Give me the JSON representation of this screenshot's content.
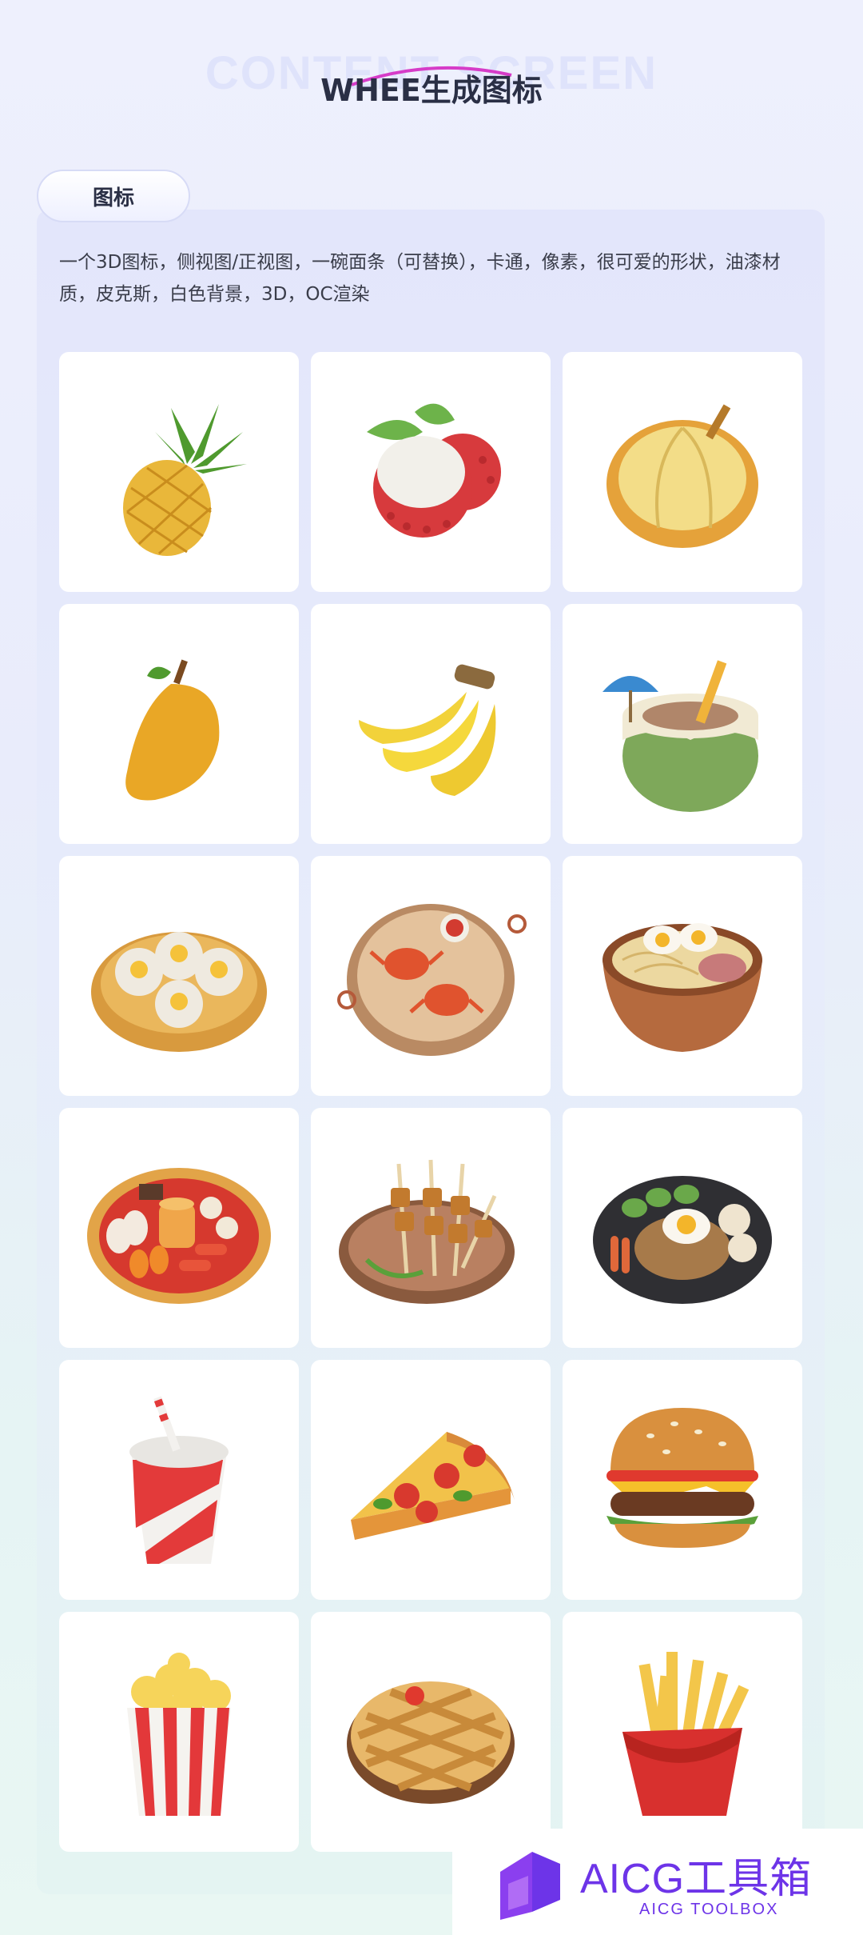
{
  "header": {
    "background_text": "CONTENT SCREEN",
    "title": "WHEE生成图标"
  },
  "section": {
    "tab_label": "图标",
    "description": "一个3D图标，侧视图/正视图，一碗面条（可替换），卡通，像素，很可爱的形状，油漆材质，皮克斯，白色背景，3D，OC渲染"
  },
  "grid": {
    "icons": [
      {
        "name": "pineapple-icon"
      },
      {
        "name": "lychee-icon"
      },
      {
        "name": "durian-icon"
      },
      {
        "name": "mango-icon"
      },
      {
        "name": "banana-icon"
      },
      {
        "name": "coconut-drink-icon"
      },
      {
        "name": "dim-sum-steamer-icon"
      },
      {
        "name": "crab-tray-icon"
      },
      {
        "name": "noodle-bowl-icon"
      },
      {
        "name": "snack-platter-icon"
      },
      {
        "name": "skewers-plate-icon"
      },
      {
        "name": "fried-rice-plate-icon"
      },
      {
        "name": "soda-cup-icon"
      },
      {
        "name": "pizza-slice-icon"
      },
      {
        "name": "burger-icon"
      },
      {
        "name": "popcorn-icon"
      },
      {
        "name": "pie-icon"
      },
      {
        "name": "fries-icon"
      }
    ]
  },
  "brand": {
    "name": "AICG工具箱",
    "subtitle": "AICG TOOLBOX"
  },
  "colors": {
    "accent": "#6d34e8",
    "title": "#2a2f45",
    "text": "#3a3d4a"
  }
}
